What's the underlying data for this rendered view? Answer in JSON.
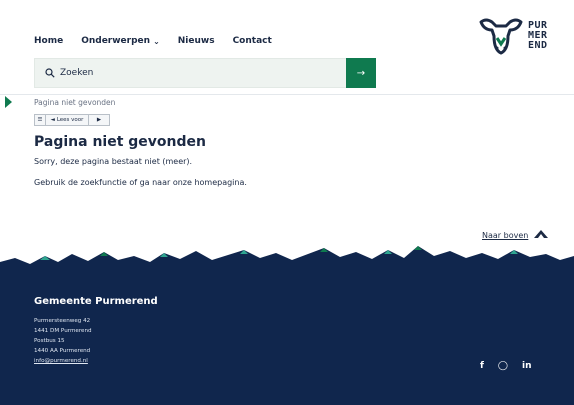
{
  "nav": {
    "home": "Home",
    "topics": "Onderwerpen",
    "news": "Nieuws",
    "contact": "Contact"
  },
  "logo": {
    "line1": "PUR",
    "line2": "MER",
    "line3": "END"
  },
  "search": {
    "placeholder": "Zoeken",
    "button_icon": "arrow-right-icon"
  },
  "breadcrumb": "Pagina niet gevonden",
  "readspeaker": {
    "label": "Lees voor"
  },
  "main": {
    "title": "Pagina niet gevonden",
    "line1": "Sorry, deze pagina bestaat niet (meer).",
    "line2": "Gebruik de zoekfunctie of ga naar onze homepagina."
  },
  "back_to_top": "Naar boven",
  "footer": {
    "title": "Gemeente Purmerend",
    "address": [
      "Purmersteenweg 42",
      "1441 DM Purmerend",
      "Postbus 15",
      "1440 AA Purmerend"
    ],
    "email": "info@purmerend.nl",
    "socials": [
      "facebook-icon",
      "instagram-icon",
      "linkedin-icon"
    ]
  },
  "colors": {
    "navy": "#10264d",
    "green": "#0f7a4f",
    "teal": "#2fa590"
  }
}
